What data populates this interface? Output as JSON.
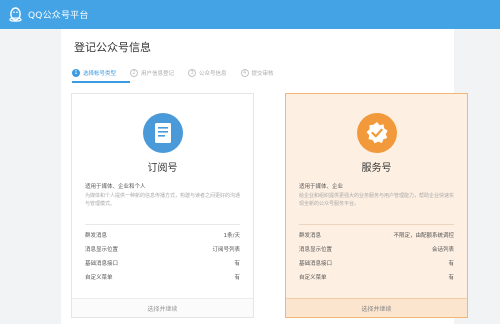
{
  "topbar": {
    "brand": "QQ公众号平台",
    "logo_icon": "qq-penguin-icon"
  },
  "page": {
    "title": "登记公众号信息"
  },
  "steps": [
    {
      "num": "1",
      "label": "选择帐号类型",
      "active": true
    },
    {
      "num": "2",
      "label": "用户信息登记",
      "active": false
    },
    {
      "num": "3",
      "label": "公众号信息",
      "active": false
    },
    {
      "num": "4",
      "label": "提交审核",
      "active": false
    }
  ],
  "cards": {
    "subscription": {
      "icon": "document-icon",
      "name": "订阅号",
      "desc1": "适用于媒体、企业和个人",
      "desc2": "为媒体和个人提供一种新的信息传播方式，构建与读者之间更好的沟通与管理模式。",
      "features": [
        {
          "label": "群发消息",
          "value": "1条/天"
        },
        {
          "label": "消息显示位置",
          "value": "订阅号列表"
        },
        {
          "label": "基础消息接口",
          "value": "有"
        },
        {
          "label": "自定义菜单",
          "value": "有"
        }
      ],
      "action": "选择并继续"
    },
    "service": {
      "icon": "verified-badge-icon",
      "name": "服务号",
      "desc1": "适用于媒体、企业",
      "desc2": "给企业和组织提供更强大的业务服务与用户管理能力，帮助企业快速实现全新的公众号服务平台。",
      "features": [
        {
          "label": "群发消息",
          "value": "不限定，由配额系统调控"
        },
        {
          "label": "消息显示位置",
          "value": "会话列表"
        },
        {
          "label": "基础消息接口",
          "value": "有"
        },
        {
          "label": "自定义菜单",
          "value": "有"
        }
      ],
      "action": "选择并继续"
    }
  },
  "colors": {
    "topbar": "#43a3e5",
    "accent": "#3c9be0",
    "service_border": "#f3b673",
    "service_bg": "#fdefe1"
  }
}
